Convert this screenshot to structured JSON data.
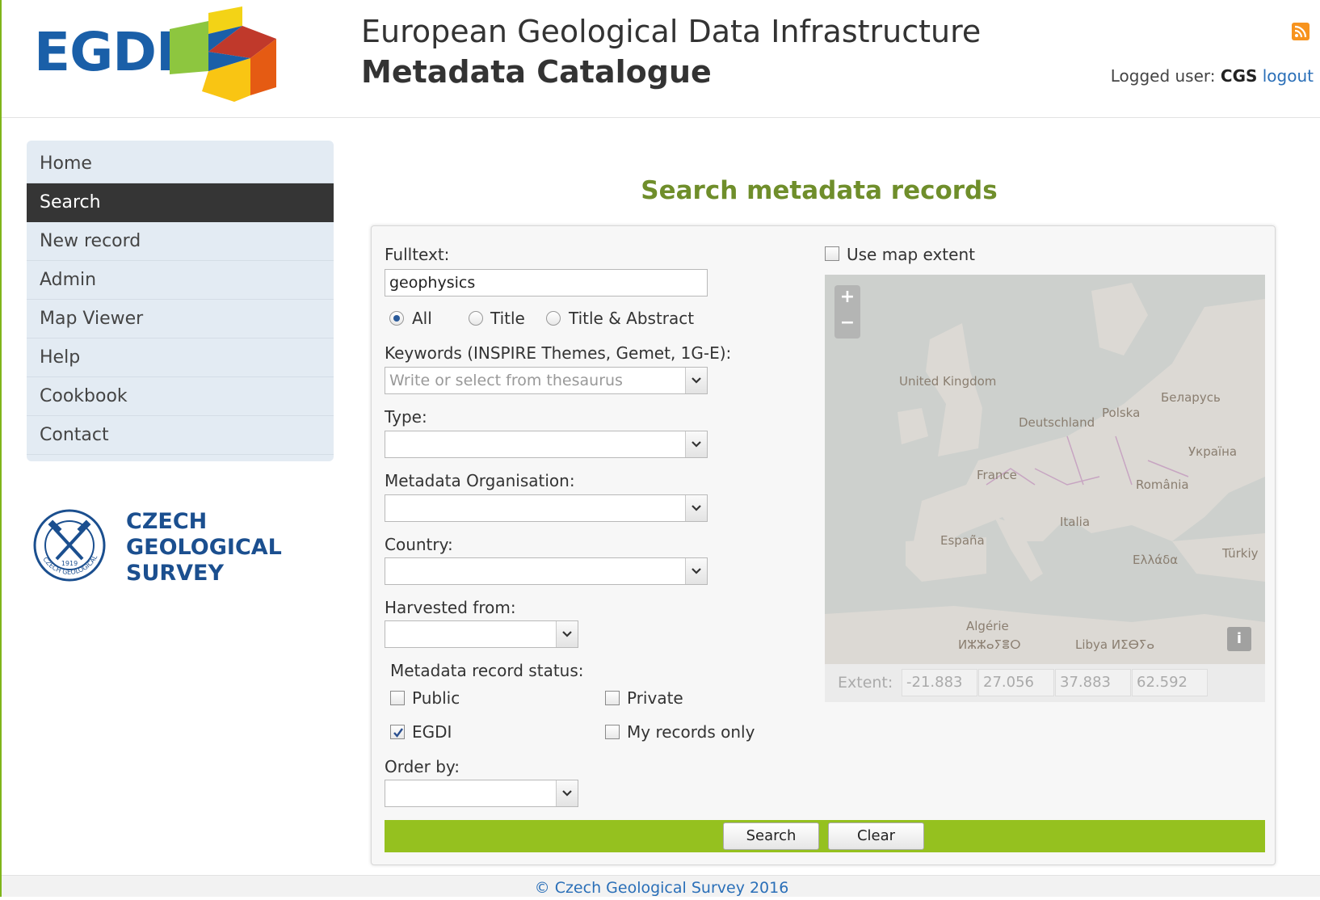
{
  "header": {
    "logo_text": "EGDI",
    "title_line1": "European Geological Data Infrastructure",
    "title_line2": "Metadata Catalogue",
    "logged_label": "Logged user:",
    "user": "CGS",
    "logout": "logout"
  },
  "sidebar": {
    "items": [
      {
        "label": "Home"
      },
      {
        "label": "Search"
      },
      {
        "label": "New record"
      },
      {
        "label": "Admin"
      },
      {
        "label": "Map Viewer"
      },
      {
        "label": "Help"
      },
      {
        "label": "Cookbook"
      },
      {
        "label": "Contact"
      }
    ],
    "active": "Search"
  },
  "cgs_logo": {
    "line1": "CZECH",
    "line2": "GEOLOGICAL",
    "line3": "SURVEY",
    "seal_year": "1919",
    "seal_text": "CZECH GEOLOGICAL SURVEY"
  },
  "main": {
    "page_title": "Search metadata records",
    "fulltext_label": "Fulltext:",
    "fulltext_value": "geophysics",
    "scope_options": [
      "All",
      "Title",
      "Title & Abstract"
    ],
    "scope_selected": "All",
    "keywords_label": "Keywords (INSPIRE Themes, Gemet, 1G-E):",
    "keywords_placeholder": "Write or select from thesaurus",
    "type_label": "Type:",
    "org_label": "Metadata Organisation:",
    "country_label": "Country:",
    "harvested_label": "Harvested from:",
    "status_label": "Metadata record status:",
    "status_options": [
      {
        "label": "Public",
        "checked": false
      },
      {
        "label": "Private",
        "checked": false
      },
      {
        "label": "EGDI",
        "checked": true
      },
      {
        "label": "My records only",
        "checked": false
      }
    ],
    "order_label": "Order by:",
    "search_button": "Search",
    "clear_button": "Clear"
  },
  "map": {
    "use_extent_label": "Use map extent",
    "use_extent_checked": false,
    "zoom_in": "+",
    "zoom_out": "−",
    "info": "i",
    "place_labels": [
      "United Kingdom",
      "Deutschland",
      "Polska",
      "Беларусь",
      "Україна",
      "France",
      "România",
      "Italia",
      "España",
      "Ελλάδα",
      "Türkiy",
      "Algérie",
      "ⵍⵣⵣⴰⵢⴻⵔ",
      "Libya ⵍⵉⴱⵢⴰ"
    ],
    "extent_label": "Extent:",
    "extent_values": [
      "-21.883",
      "27.056",
      "37.883",
      "62.592"
    ]
  },
  "footer": {
    "text": "© Czech Geological Survey 2016"
  },
  "colors": {
    "brand_blue": "#1a5fa8",
    "title_green": "#6f8e2b",
    "action_green": "#95c11f",
    "nav_active": "#353535",
    "nav_bg": "#e3ebf3"
  }
}
